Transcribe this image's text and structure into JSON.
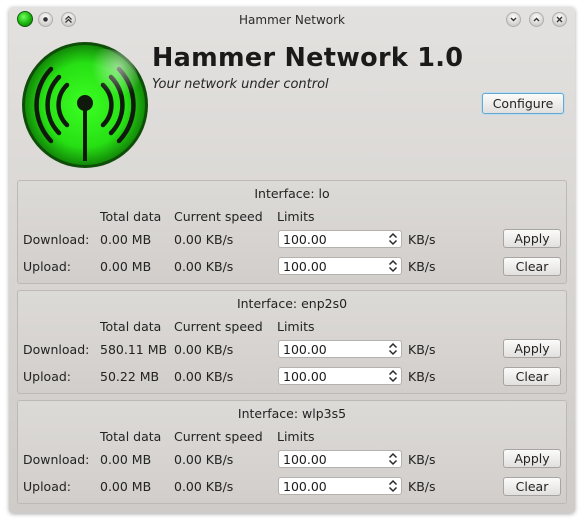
{
  "window": {
    "title": "Hammer Network",
    "titlebar_buttons_left": [
      "app-menu-icon",
      "keep-below-icon",
      "keep-above-icon"
    ],
    "titlebar_buttons_right": [
      "minimize-icon",
      "maximize-icon",
      "close-icon"
    ]
  },
  "header": {
    "title": "Hammer Network 1.0",
    "subtitle": "Your network under control",
    "configure_label": "Configure",
    "logo_icon": "wifi-antenna-icon",
    "logo_color": "#2ee81a"
  },
  "columns": {
    "total_data": "Total data",
    "current_speed": "Current speed",
    "limits": "Limits"
  },
  "row_labels": {
    "download": "Download:",
    "upload": "Upload:"
  },
  "unit_label": "KB/s",
  "buttons": {
    "apply": "Apply",
    "clear": "Clear"
  },
  "interfaces": [
    {
      "title": "Interface: lo",
      "download": {
        "total": "0.00 MB",
        "speed": "0.00 KB/s",
        "limit": "100.00"
      },
      "upload": {
        "total": "0.00 MB",
        "speed": "0.00 KB/s",
        "limit": "100.00"
      }
    },
    {
      "title": "Interface: enp2s0",
      "download": {
        "total": "580.11 MB",
        "speed": "0.00 KB/s",
        "limit": "100.00"
      },
      "upload": {
        "total": "50.22 MB",
        "speed": "0.00 KB/s",
        "limit": "100.00"
      }
    },
    {
      "title": "Interface: wlp3s5",
      "download": {
        "total": "0.00 MB",
        "speed": "0.00 KB/s",
        "limit": "100.00"
      },
      "upload": {
        "total": "0.00 MB",
        "speed": "0.00 KB/s",
        "limit": "100.00"
      }
    }
  ]
}
